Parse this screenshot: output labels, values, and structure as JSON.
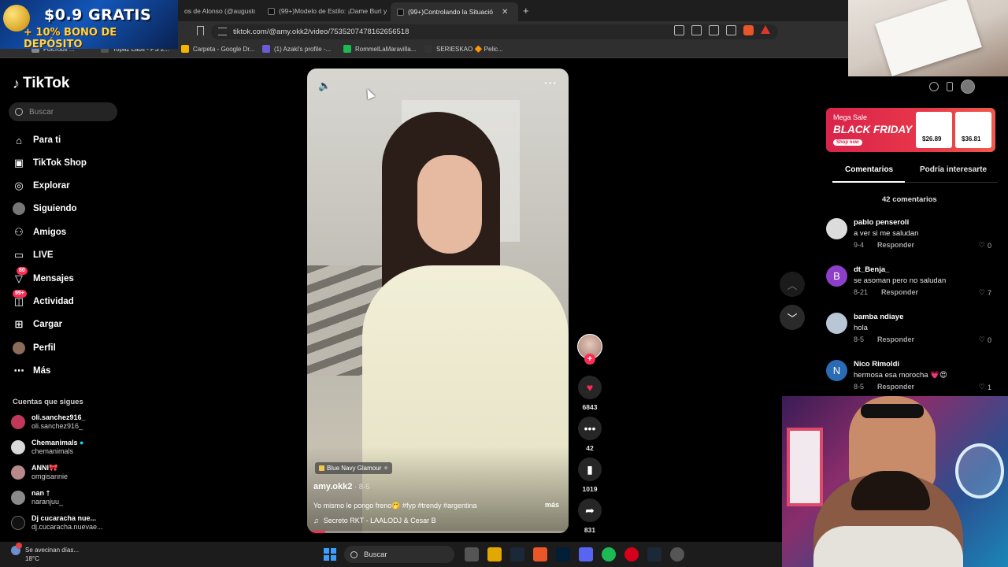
{
  "browser": {
    "tabs": [
      {
        "title": "os de Alonso (@augusto.g",
        "active": false
      },
      {
        "title": "(99+)Modelo de Estilo: ¡Dame Buri y",
        "active": false
      },
      {
        "title": "(99+)Controlando la Situació",
        "active": true
      }
    ],
    "new_tab_label": "+",
    "url": "tiktok.com/@amy.okk2/video/7535207478162656518",
    "bookmarks": [
      "Fulcrobs ...",
      "Topaz Labs - PS 2...",
      "Carpeta - Google Dr...",
      "(1) Azaki's profile -...",
      "RommelLaMaravilla...",
      "SERIESKAO 🔶 Pelic..."
    ],
    "bookmark_colors": [
      "#888888",
      "#555555",
      "#f4b400",
      "#6b5bd6",
      "#1db954",
      "#333333"
    ]
  },
  "casino_ad": {
    "line1": "$0.9 GRATIS",
    "line2": "+ 10% BONO DE DEPÓSITO"
  },
  "tiktok": {
    "logo": "TikTok",
    "search_placeholder": "Buscar",
    "nav": [
      {
        "label": "Para ti",
        "icon": "home-icon",
        "badge": ""
      },
      {
        "label": "TikTok Shop",
        "icon": "shop-icon",
        "badge": ""
      },
      {
        "label": "Explorar",
        "icon": "compass-icon",
        "badge": ""
      },
      {
        "label": "Siguiendo",
        "icon": "following-icon",
        "badge": ""
      },
      {
        "label": "Amigos",
        "icon": "friends-icon",
        "badge": ""
      },
      {
        "label": "LIVE",
        "icon": "live-icon",
        "badge": ""
      },
      {
        "label": "Mensajes",
        "icon": "messages-icon",
        "badge": "80"
      },
      {
        "label": "Actividad",
        "icon": "activity-icon",
        "badge": "99+"
      },
      {
        "label": "Cargar",
        "icon": "upload-icon",
        "badge": ""
      },
      {
        "label": "Perfil",
        "icon": "profile-icon",
        "badge": ""
      },
      {
        "label": "Más",
        "icon": "more-icon",
        "badge": ""
      }
    ],
    "following_title": "Cuentas que sigues",
    "following": [
      {
        "name": "oli.sanchez916_",
        "handle": "oli.sanchez916_",
        "color": "#c0395a"
      },
      {
        "name": "Chemanimals",
        "handle": "chemanimals",
        "color": "#d9d9d9"
      },
      {
        "name": "ANNI🎀",
        "handle": "omgisannie",
        "color": "#b98a8a"
      },
      {
        "name": "nan †",
        "handle": "naranjuu_",
        "color": "#8a8a8a"
      },
      {
        "name": "Dj cucaracha nue...",
        "handle": "dj.cucaracha.nuevae...",
        "color": "#111111"
      }
    ]
  },
  "video": {
    "badge": "Blue Navy Glamour ✧",
    "author": "amy.okk2",
    "date": " · 8-5",
    "caption": "Yo mismo le pongo freno🤭 #fyp #trendy #argentina",
    "more": "más",
    "music": "Secreto RKT - LAALODJ & Cesar B",
    "progress": 0.07
  },
  "actions": {
    "likes": "6843",
    "comments": "42",
    "saves": "1019",
    "shares": "831"
  },
  "panel": {
    "ad": {
      "mega": "Mega Sale",
      "title": "BLACK FRIDAY",
      "shop": "Shop now",
      "price1": "$26.89",
      "price2": "$36.81"
    },
    "tab_comments": "Comentarios",
    "tab_interest": "Podría interesarte",
    "comment_count": "42 comentarios",
    "comments": [
      {
        "user": "pablo penseroli",
        "text": "a ver si me saludan",
        "date": "9-4",
        "reply": "Responder",
        "likes": "0",
        "avatar": "",
        "color": "#dcdcdc"
      },
      {
        "user": "dt_Benja_",
        "text": "se asoman pero no saludan",
        "date": "8-21",
        "reply": "Responder",
        "likes": "7",
        "avatar": "B",
        "color": "#8e3fc9"
      },
      {
        "user": "bamba ndiaye",
        "text": "hola",
        "date": "8-5",
        "reply": "Responder",
        "likes": "0",
        "avatar": "",
        "color": "#b9c6d6"
      },
      {
        "user": "Nico Rimoldi",
        "text": "hermosa esa morocha 💗😍",
        "date": "8-5",
        "reply": "Responder",
        "likes": "1",
        "avatar": "N",
        "color": "#2a6bb5"
      }
    ]
  },
  "taskbar": {
    "weather_title": "Se avecinan días...",
    "weather_temp": "18°C",
    "search": "Buscar",
    "apps": [
      "Files",
      "Explorer",
      "Steam",
      "Brave",
      "Ps",
      "Discord",
      "Spotify",
      "Opera",
      "Steam2",
      "App"
    ],
    "app_colors": [
      "#555555",
      "#e0a800",
      "#1b2838",
      "#e8562a",
      "#001e36",
      "#5865f2",
      "#1db954",
      "#d6001c",
      "#1b2838",
      "#555555"
    ]
  }
}
